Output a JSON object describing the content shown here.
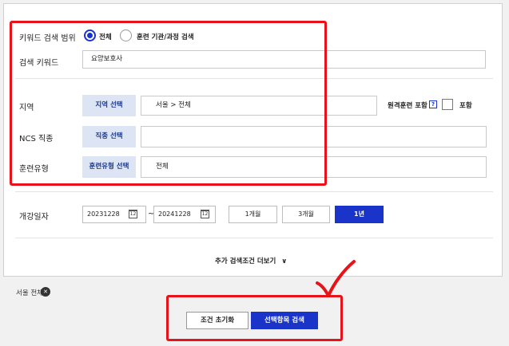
{
  "keyword_scope": {
    "label": "키워드 검색 범위",
    "options": [
      {
        "label": "전체",
        "selected": true
      },
      {
        "label": "훈련 기관/과정 검색",
        "selected": false
      }
    ]
  },
  "keyword": {
    "label": "검색 키워드",
    "value": "요양보호사"
  },
  "region": {
    "label": "지역",
    "button": "지역 선택",
    "value": "서울 > 전체",
    "remote_label": "원격훈련 포함",
    "remote_help": "?",
    "remote_check_label": "포함"
  },
  "ncs": {
    "label": "NCS 직종",
    "button": "직종 선택",
    "value": ""
  },
  "training_type": {
    "label": "훈련유형",
    "button": "훈련유형 선택",
    "value": "전체"
  },
  "start_date": {
    "label": "개강일자",
    "from": "20231228",
    "to": "20241228",
    "separator": "~",
    "calendar_glyph": "12",
    "periods": [
      "1개월",
      "3개월",
      "1년"
    ],
    "active_period": "1년"
  },
  "more_conditions": {
    "label": "추가 검색조건 더보기",
    "chevron": "∨"
  },
  "selected_tag": {
    "label": "서울 전체",
    "remove": "✕"
  },
  "actions": {
    "reset": "조건 초기화",
    "search": "선택항목 검색"
  },
  "colors": {
    "accent": "#1a33c8",
    "highlight": "#e8131a",
    "select_button_bg": "#dde5f5"
  }
}
